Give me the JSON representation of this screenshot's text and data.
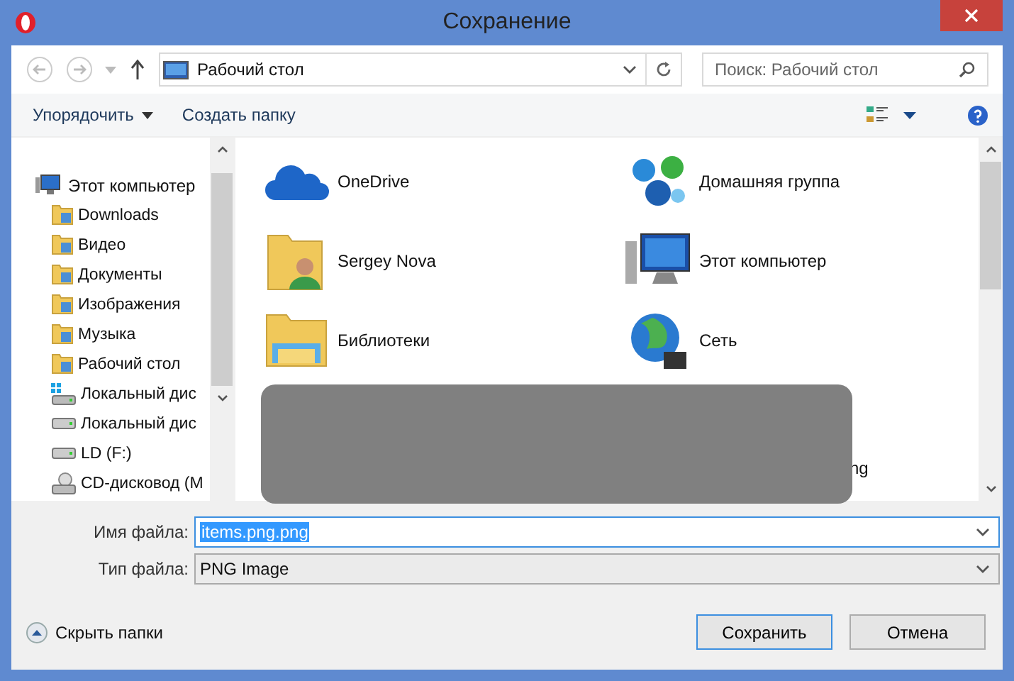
{
  "window": {
    "title": "Сохранение"
  },
  "address": {
    "location": "Рабочий стол",
    "search_placeholder": "Поиск: Рабочий стол"
  },
  "toolbar": {
    "organize": "Упорядочить",
    "new_folder": "Создать папку"
  },
  "sidebar": {
    "items": [
      {
        "label": "Этот компьютер",
        "kind": "computer",
        "children": [
          {
            "label": "Downloads",
            "kind": "folder"
          },
          {
            "label": "Видео",
            "kind": "folder"
          },
          {
            "label": "Документы",
            "kind": "folder"
          },
          {
            "label": "Изображения",
            "kind": "folder"
          },
          {
            "label": "Музыка",
            "kind": "folder"
          },
          {
            "label": "Рабочий стол",
            "kind": "folder"
          },
          {
            "label": "Локальный дис",
            "kind": "system-drive"
          },
          {
            "label": "Локальный дис",
            "kind": "drive"
          },
          {
            "label": "LD (F:)",
            "kind": "drive"
          },
          {
            "label": "CD-дисковод (M",
            "kind": "cd"
          }
        ]
      }
    ]
  },
  "files": [
    {
      "label": "OneDrive",
      "kind": "cloud"
    },
    {
      "label": "Домашняя группа",
      "kind": "homegroup"
    },
    {
      "label": "Sergey Nova",
      "kind": "user"
    },
    {
      "label": "Этот компьютер",
      "kind": "computer"
    },
    {
      "label": "Библиотеки",
      "kind": "library"
    },
    {
      "label": "Сеть",
      "kind": "network"
    }
  ],
  "partial_file": {
    "label": "ng"
  },
  "form": {
    "filename_label": "Имя файла:",
    "filename": "items.png.png",
    "type_label": "Тип файла:",
    "type": "PNG Image"
  },
  "hide_folders": "Скрыть папки",
  "buttons": {
    "save": "Сохранить",
    "cancel": "Отмена"
  }
}
